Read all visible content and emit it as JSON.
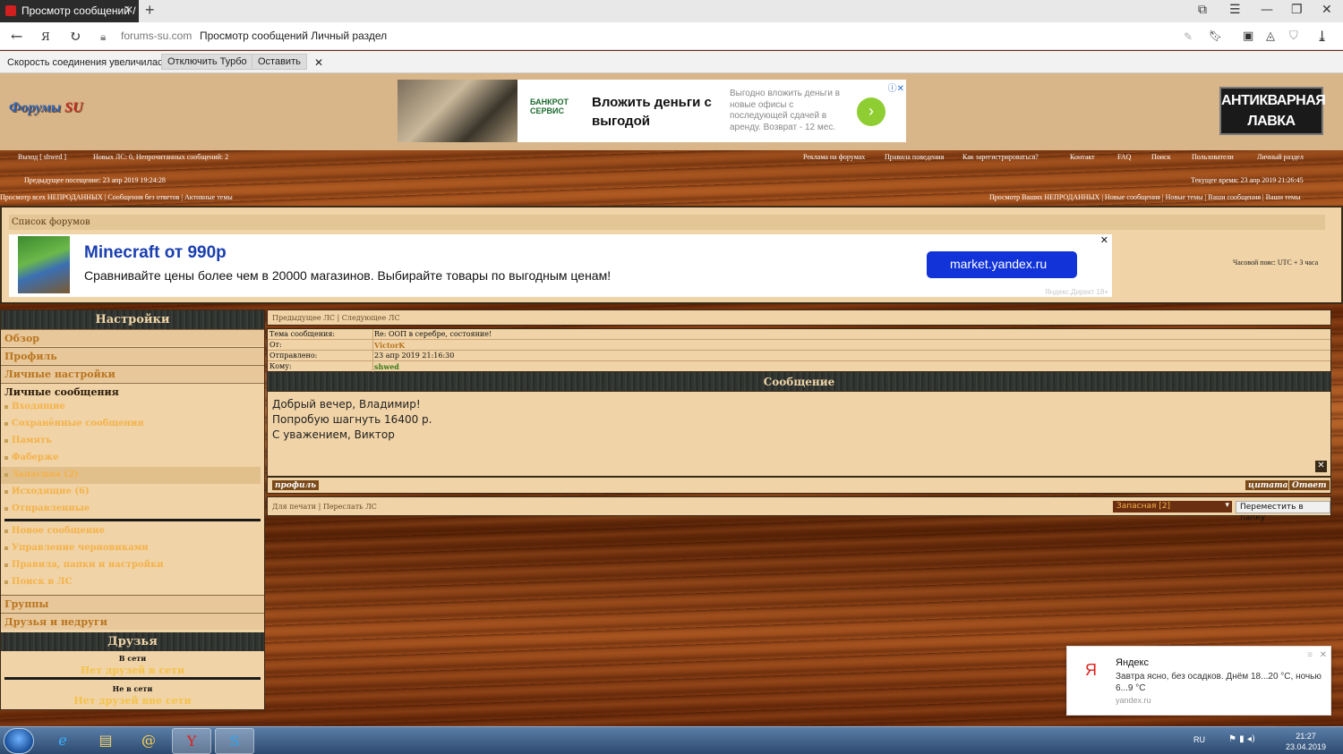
{
  "browser": {
    "tab_title": "Просмотр сообщений /",
    "domain": "forums-su.com",
    "page_title": "Просмотр сообщений Личный раздел"
  },
  "turbo": {
    "message": "Скорость соединения увеличилась.",
    "disable": "Отключить Турбо",
    "keep": "Оставить"
  },
  "header": {
    "logo_main": "Форумы ",
    "logo_accent": "SU",
    "ad": {
      "brand": "БАНКРОТ СЕРВИС",
      "headline": "Вложить деньги с выгодой",
      "desc": "Выгодно вложить деньги в новые офисы с последующей сдачей в аренду. Возврат - 12 мес."
    },
    "banner": "АНТИКВАРНАЯ ЛАВКА"
  },
  "nav": {
    "logout": "Выход [ shwed ]",
    "new_pm": "Новых ЛС: 0, Непрочитанных сообщений: 2",
    "ads": "Реклама на форумах",
    "rules": "Правила поведения",
    "register": "Как зарегистрироваться?",
    "contact": "Контакт",
    "faq": "FAQ",
    "search": "Поиск",
    "users": "Пользователи",
    "personal": "Личный раздел",
    "last_visit": "Предыдущее посещение: 23 апр 2019 19:24:28",
    "current_time": "Текущее время: 23 апр 2019 21:26:45",
    "left_links": "Просмотр всех НЕПРОДАННЫХ | Сообщения без ответов | Активные темы",
    "right_links": "Просмотр Ваших НЕПРОДАННЫХ | Новые сообщения | Новые темы | Ваши сообщения | Ваши темы"
  },
  "forumlist": {
    "title": "Список форумов",
    "ad": {
      "headline": "Minecraft от 990р",
      "desc": "Сравнивайте цены более чем в 20000 магазинов. Выбирайте товары по выгодным ценам!",
      "button": "market.yandex.ru",
      "label": "Яндекс.Директ 18+"
    },
    "timezone": "Часовой пояс: UTC + 3 часа"
  },
  "sidebar": {
    "title": "Настройки",
    "overview": "Обзор",
    "profile": "Профиль",
    "settings": "Личные настройки",
    "pm": "Личные сообщения",
    "items": [
      "Входящие",
      "Сохранённые сообщения",
      "Память",
      "Фаберже",
      "Запасная (2)",
      "Исходящие (6)",
      "Отправленные"
    ],
    "items2": [
      "Новое сообщение",
      "Управление черновиками",
      "Правила, папки и настройки",
      "Поиск в ЛС"
    ],
    "groups": "Группы",
    "friends_foes": "Друзья и недруги",
    "friends_title": "Друзья",
    "online": "В сети",
    "online_none": "Нет друзей в сети",
    "offline": "Не в сети",
    "offline_none": "Нет друзей вне сети"
  },
  "message": {
    "nav": "Предыдущее ЛС | Следующее ЛС",
    "subject_label": "Тема сообщения:",
    "subject": "Re: ООП в серебре, состояние!",
    "from_label": "От:",
    "from": "VictorK",
    "sent_label": "Отправлено:",
    "sent": "23 апр 2019 21:16:30",
    "to_label": "Кому:",
    "to": "shwed",
    "body_title": "Сообщение",
    "lines": [
      "Добрый вечер, Владимир!",
      "Попробую шагнуть 16400 р.",
      "С уважением, Виктор"
    ],
    "profile_btn": "профиль",
    "quote_btn": "цитата",
    "reply_btn": "Ответ",
    "print": "Для печати | Переслать ЛС",
    "folder": "Запасная [2]",
    "move": "Переместить в папку"
  },
  "notification": {
    "title": "Яндекс",
    "body": "Завтра ясно, без осадков. Днём 18...20 °C, ночью 6...9 °C",
    "source": "yandex.ru"
  },
  "taskbar": {
    "lang": "RU",
    "time": "21:27",
    "date": "23.04.2019"
  }
}
